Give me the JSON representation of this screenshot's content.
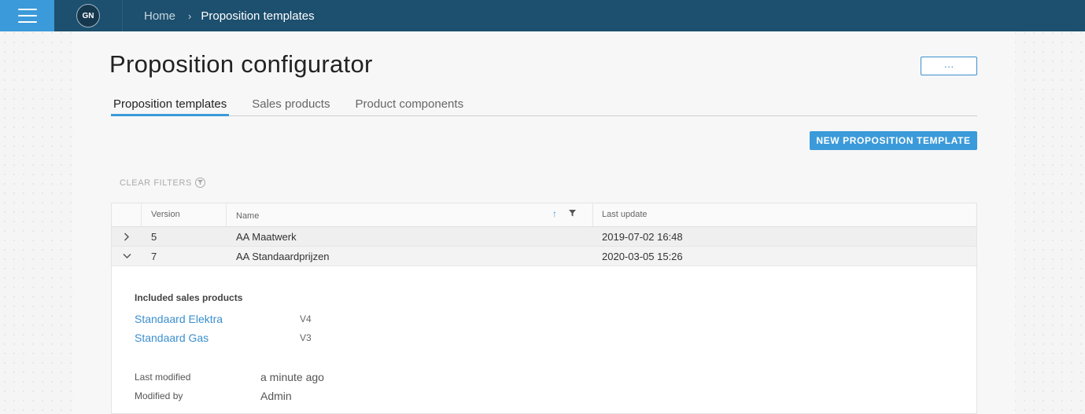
{
  "header": {
    "menu_icon": "hamburger-icon",
    "avatar_initials": "GN",
    "breadcrumb": {
      "home": "Home",
      "separator": "›",
      "current": "Proposition templates"
    }
  },
  "page": {
    "title": "Proposition configurator",
    "more_label": "···",
    "tabs": [
      {
        "label": "Proposition templates",
        "active": true
      },
      {
        "label": "Sales products",
        "active": false
      },
      {
        "label": "Product components",
        "active": false
      }
    ],
    "new_button": "NEW PROPOSITION TEMPLATE",
    "clear_filters": "CLEAR FILTERS"
  },
  "table": {
    "columns": {
      "version": "Version",
      "name": "Name",
      "last_update": "Last update"
    },
    "sort_icon": "arrow-up-icon",
    "filter_icon": "filter-icon",
    "rows": [
      {
        "version": "5",
        "name": "AA Maatwerk",
        "last_update": "2019-07-02 16:48",
        "expanded": false
      },
      {
        "version": "7",
        "name": "AA Standaardprijzen",
        "last_update": "2020-03-05 15:26",
        "expanded": true
      }
    ],
    "detail": {
      "heading": "Included sales products",
      "sales_products": [
        {
          "name": "Standaard Elektra",
          "version": "V4"
        },
        {
          "name": "Standaard Gas",
          "version": "V3"
        }
      ],
      "last_modified_label": "Last modified",
      "last_modified_value": "a minute ago",
      "modified_by_label": "Modified by",
      "modified_by_value": "Admin"
    }
  },
  "colors": {
    "header_bg": "#1d4f6e",
    "accent": "#3b9ad9",
    "link": "#3b8fcf"
  }
}
